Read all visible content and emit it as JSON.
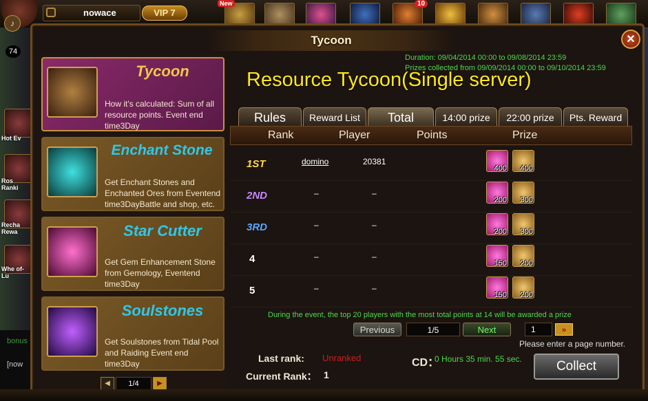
{
  "topbar": {
    "player_name": "nowace",
    "vip": "VIP 7",
    "new_badge": "New",
    "ten_badge": "10",
    "level": "74"
  },
  "sidebar": {
    "items": [
      {
        "label": "Hot Ev"
      },
      {
        "label": "Ros Ranki"
      },
      {
        "label": "Recha Rewa"
      },
      {
        "label": "Whe of-Lu"
      }
    ],
    "chat": [
      "bonus",
      "[now"
    ]
  },
  "window": {
    "title": "Tycoon",
    "close_label": "✕"
  },
  "events": [
    {
      "title": "Tycoon",
      "desc": "How it's calculated: Sum of all resource points. Event end time3Day",
      "color": "#f0c848",
      "active": true
    },
    {
      "title": "Enchant Stone",
      "desc": "Get Enchant Stones and Enchanted Ores from Eventend time3DayBattle and shop, etc.",
      "color": "#2fc8e8",
      "active": false
    },
    {
      "title": "Star Cutter",
      "desc": "Get Gem Enhancement Stone from Gemology, Eventend time3Day",
      "color": "#2fc8e8",
      "active": false
    },
    {
      "title": "Soulstones",
      "desc": "Get Soulstones from Tidal Pool and Raiding Event end time3Day",
      "color": "#2fc8e8",
      "active": false
    }
  ],
  "left_pager": {
    "page": "1/4",
    "prev": "◀",
    "next": "▶"
  },
  "info": {
    "duration": "Duration: 09/04/2014 00:00 to 09/08/2014 23:59",
    "collect_period": "Prizes collected from 09/09/2014 00:00 to 09/10/2014 23:59",
    "headline": "Resource Tycoon(Single server)"
  },
  "tabs": [
    {
      "label": "Rules",
      "active": false
    },
    {
      "label": "Reward List",
      "active": false
    },
    {
      "label": "Total",
      "active": true
    },
    {
      "label": "14:00 prize",
      "active": false
    },
    {
      "label": "22:00 prize",
      "active": false
    },
    {
      "label": "Pts. Reward",
      "active": false
    }
  ],
  "table": {
    "headers": {
      "rank": "Rank",
      "player": "Player",
      "points": "Points",
      "prize": "Prize"
    },
    "rows": [
      {
        "rank": "1ST",
        "player": "domino",
        "points": "20381",
        "stars": "400",
        "coins": "400",
        "rank_color": "#ffd84a"
      },
      {
        "rank": "2ND",
        "player": "–",
        "points": "–",
        "stars": "200",
        "coins": "300",
        "rank_color": "#c888ff"
      },
      {
        "rank": "3RD",
        "player": "–",
        "points": "–",
        "stars": "200",
        "coins": "300",
        "rank_color": "#58a8ff"
      },
      {
        "rank": "4",
        "player": "–",
        "points": "–",
        "stars": "150",
        "coins": "200",
        "rank_color": "#ffffff"
      },
      {
        "rank": "5",
        "player": "–",
        "points": "–",
        "stars": "150",
        "coins": "200",
        "rank_color": "#ffffff"
      }
    ]
  },
  "notice": "During the event, the top 20 players with the most total points at 14 will be awarded a prize",
  "pager": {
    "previous": "Previous",
    "page": "1/5",
    "next": "Next",
    "input_value": "1",
    "go": "»",
    "hint": "Please enter a page number."
  },
  "footer": {
    "last_rank_label": "Last rank:",
    "last_rank_value": "Unranked",
    "current_rank_label": "Current Rank：",
    "current_rank_value": "1",
    "cd_label": "CD：",
    "cd_value": "0 Hours 35 min. 55 sec.",
    "collect": "Collect"
  }
}
